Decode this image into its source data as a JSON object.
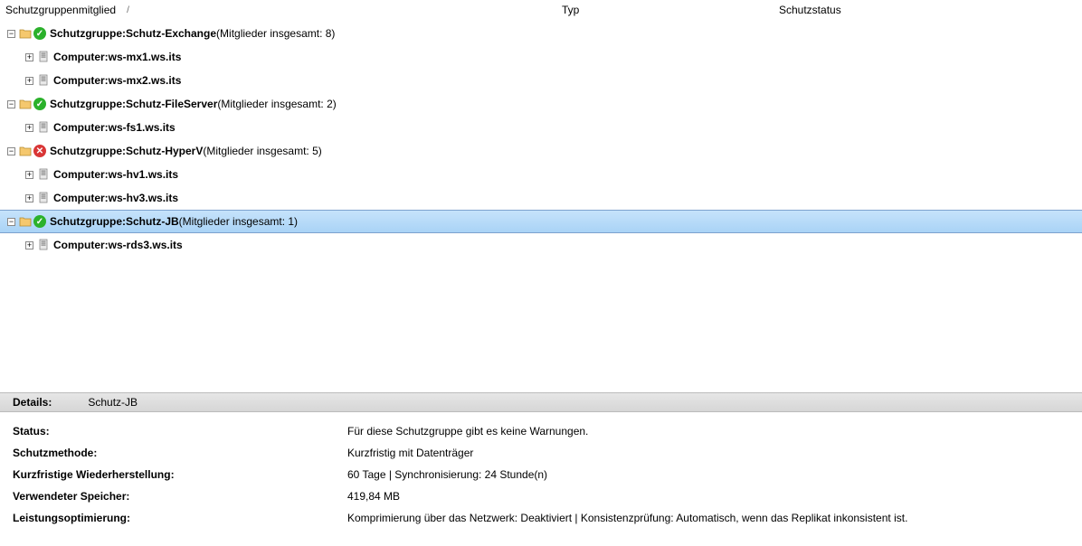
{
  "columns": {
    "member": "Schutzgruppenmitglied",
    "type": "Typ",
    "status": "Schutzstatus"
  },
  "groups": [
    {
      "prefix": "Schutzgruppe: ",
      "name": "Schutz-Exchange",
      "status": "ok",
      "count": "(Mitglieder insgesamt: 8)",
      "expanded": true,
      "selected": false,
      "children": [
        {
          "prefix": "Computer: ",
          "name": "ws-mx1.ws.its",
          "expanded": false
        },
        {
          "prefix": "Computer: ",
          "name": "ws-mx2.ws.its",
          "expanded": false
        }
      ]
    },
    {
      "prefix": "Schutzgruppe: ",
      "name": "Schutz-FileServer",
      "status": "ok",
      "count": "(Mitglieder insgesamt: 2)",
      "expanded": true,
      "selected": false,
      "children": [
        {
          "prefix": "Computer: ",
          "name": "ws-fs1.ws.its",
          "expanded": false
        }
      ]
    },
    {
      "prefix": "Schutzgruppe: ",
      "name": "Schutz-HyperV",
      "status": "err",
      "count": "(Mitglieder insgesamt: 5)",
      "expanded": true,
      "selected": false,
      "children": [
        {
          "prefix": "Computer: ",
          "name": "ws-hv1.ws.its",
          "expanded": false
        },
        {
          "prefix": "Computer: ",
          "name": "ws-hv3.ws.its",
          "expanded": false
        }
      ]
    },
    {
      "prefix": "Schutzgruppe: ",
      "name": "Schutz-JB",
      "status": "ok",
      "count": "(Mitglieder insgesamt: 1)",
      "expanded": true,
      "selected": true,
      "children": [
        {
          "prefix": "Computer: ",
          "name": "ws-rds3.ws.its",
          "expanded": false
        }
      ]
    }
  ],
  "details": {
    "header_label": "Details:",
    "header_name": "Schutz-JB",
    "rows": [
      {
        "label": "Status:",
        "value": "Für diese Schutzgruppe gibt es keine Warnungen."
      },
      {
        "label": "Schutzmethode:",
        "value": "Kurzfristig mit Datenträger"
      },
      {
        "label": "Kurzfristige Wiederherstellung:",
        "value": "60 Tage | Synchronisierung: 24 Stunde(n)"
      },
      {
        "label": "Verwendeter Speicher:",
        "value": "419,84 MB"
      },
      {
        "label": "Leistungsoptimierung:",
        "value": "Komprimierung über das Netzwerk: Deaktiviert | Konsistenzprüfung: Automatisch, wenn das Replikat inkonsistent ist."
      }
    ]
  }
}
